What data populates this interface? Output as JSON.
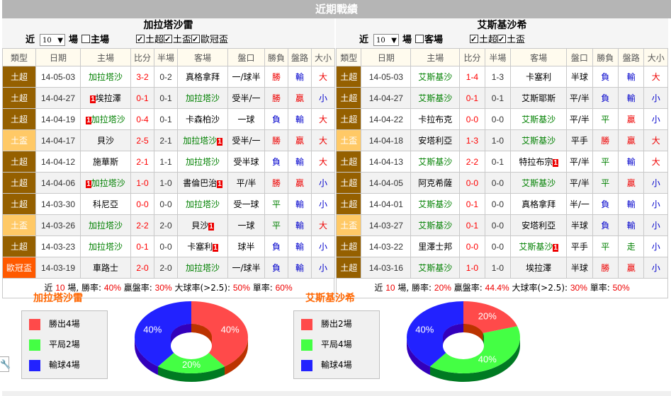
{
  "header": {
    "title": "近期戰績"
  },
  "left": {
    "team": "加拉塔沙雷",
    "controls": {
      "recent_label": "近",
      "count": "10",
      "unit_label": "場",
      "venue_label": "主場",
      "venue_checked": false,
      "filters": [
        {
          "label": "土超",
          "checked": true
        },
        {
          "label": "土盃",
          "checked": true
        },
        {
          "label": "歐冠盃",
          "checked": true
        }
      ]
    },
    "columns": [
      "類型",
      "日期",
      "主場",
      "比分",
      "半場",
      "客場",
      "盤口",
      "勝負",
      "盤路",
      "大小"
    ],
    "rows": [
      {
        "type": "土超",
        "type_kind": "super",
        "date": "14-05-03",
        "home": "加拉塔沙",
        "home_team": true,
        "home_red": "",
        "score": "3-2",
        "half": "0-2",
        "away": "真格拿拜",
        "away_team": false,
        "away_red": "",
        "handicap": "一/球半",
        "result": "勝",
        "hc_result": "輸",
        "ou": "大"
      },
      {
        "type": "土超",
        "type_kind": "super",
        "date": "14-04-27",
        "home": "埃拉澤",
        "home_team": false,
        "home_red": "1",
        "score": "0-1",
        "half": "0-1",
        "away": "加拉塔沙",
        "away_team": true,
        "away_red": "",
        "handicap": "受半/一",
        "result": "勝",
        "hc_result": "贏",
        "ou": "小"
      },
      {
        "type": "土超",
        "type_kind": "super",
        "date": "14-04-19",
        "home": "加拉塔沙",
        "home_team": true,
        "home_red": "1",
        "score": "0-4",
        "half": "0-1",
        "away": "卡森柏沙",
        "away_team": false,
        "away_red": "",
        "handicap": "一球",
        "result": "負",
        "hc_result": "輸",
        "ou": "大"
      },
      {
        "type": "土盃",
        "type_kind": "cup",
        "date": "14-04-17",
        "home": "貝沙",
        "home_team": false,
        "home_red": "",
        "score": "2-5",
        "half": "2-1",
        "away": "加拉塔沙",
        "away_team": true,
        "away_red": "1",
        "handicap": "受半/一",
        "result": "勝",
        "hc_result": "贏",
        "ou": "大"
      },
      {
        "type": "土超",
        "type_kind": "super",
        "date": "14-04-12",
        "home": "施華斯",
        "home_team": false,
        "home_red": "",
        "score": "2-1",
        "half": "1-1",
        "away": "加拉塔沙",
        "away_team": true,
        "away_red": "",
        "handicap": "受半球",
        "result": "負",
        "hc_result": "輸",
        "ou": "大"
      },
      {
        "type": "土超",
        "type_kind": "super",
        "date": "14-04-06",
        "home": "加拉塔沙",
        "home_team": true,
        "home_red": "1",
        "score": "1-0",
        "half": "1-0",
        "away": "書倫巴治",
        "away_team": false,
        "away_red": "1",
        "handicap": "平/半",
        "result": "勝",
        "hc_result": "贏",
        "ou": "小"
      },
      {
        "type": "土超",
        "type_kind": "super",
        "date": "14-03-30",
        "home": "科尼亞",
        "home_team": false,
        "home_red": "",
        "score": "0-0",
        "half": "0-0",
        "away": "加拉塔沙",
        "away_team": true,
        "away_red": "",
        "handicap": "受一球",
        "result": "平",
        "hc_result": "輸",
        "ou": "小"
      },
      {
        "type": "土盃",
        "type_kind": "cup",
        "date": "14-03-26",
        "home": "加拉塔沙",
        "home_team": true,
        "home_red": "",
        "score": "2-2",
        "half": "2-0",
        "away": "貝沙",
        "away_team": false,
        "away_red": "1",
        "handicap": "一球",
        "result": "平",
        "hc_result": "輸",
        "ou": "大"
      },
      {
        "type": "土超",
        "type_kind": "super",
        "date": "14-03-23",
        "home": "加拉塔沙",
        "home_team": true,
        "home_red": "",
        "score": "0-1",
        "half": "0-0",
        "away": "卡塞利",
        "away_team": false,
        "away_red": "1",
        "handicap": "球半",
        "result": "負",
        "hc_result": "輸",
        "ou": "小"
      },
      {
        "type": "歐冠盃",
        "type_kind": "ucl",
        "date": "14-03-19",
        "home": "車路士",
        "home_team": false,
        "home_red": "",
        "score": "2-0",
        "half": "2-0",
        "away": "加拉塔沙",
        "away_team": true,
        "away_red": "",
        "handicap": "一/球半",
        "result": "負",
        "hc_result": "輸",
        "ou": "小"
      }
    ],
    "summary": {
      "prefix": "近",
      "count": "10",
      "suffix": "場,",
      "win_label": "勝率:",
      "win": "40%",
      "hc_label": "贏盤率:",
      "hc": "30%",
      "over_label": "大球率(>2.5):",
      "over": "50%",
      "odd_label": "單率:",
      "odd": "60%"
    }
  },
  "right": {
    "team": "艾斯基沙希",
    "controls": {
      "recent_label": "近",
      "count": "10",
      "unit_label": "場",
      "venue_label": "客場",
      "venue_checked": false,
      "filters": [
        {
          "label": "土超",
          "checked": true
        },
        {
          "label": "土盃",
          "checked": true
        }
      ]
    },
    "columns": [
      "類型",
      "日期",
      "主場",
      "比分",
      "半場",
      "客場",
      "盤口",
      "勝負",
      "盤路",
      "大小"
    ],
    "rows": [
      {
        "type": "土超",
        "type_kind": "super",
        "date": "14-05-03",
        "home": "艾斯基沙",
        "home_team": true,
        "home_red": "",
        "score": "1-4",
        "half": "1-3",
        "away": "卡塞利",
        "away_team": false,
        "away_red": "",
        "handicap": "半球",
        "result": "負",
        "hc_result": "輸",
        "ou": "大"
      },
      {
        "type": "土超",
        "type_kind": "super",
        "date": "14-04-27",
        "home": "艾斯基沙",
        "home_team": true,
        "home_red": "",
        "score": "0-1",
        "half": "0-1",
        "away": "艾斯耶斯",
        "away_team": false,
        "away_red": "",
        "handicap": "平/半",
        "result": "負",
        "hc_result": "輸",
        "ou": "小"
      },
      {
        "type": "土超",
        "type_kind": "super",
        "date": "14-04-22",
        "home": "卡拉布克",
        "home_team": false,
        "home_red": "",
        "score": "0-0",
        "half": "0-0",
        "away": "艾斯基沙",
        "away_team": true,
        "away_red": "",
        "handicap": "平/半",
        "result": "平",
        "hc_result": "贏",
        "ou": "小"
      },
      {
        "type": "土盃",
        "type_kind": "cup",
        "date": "14-04-18",
        "home": "安塔利亞",
        "home_team": false,
        "home_red": "",
        "score": "1-3",
        "half": "1-0",
        "away": "艾斯基沙",
        "away_team": true,
        "away_red": "",
        "handicap": "平手",
        "result": "勝",
        "hc_result": "贏",
        "ou": "大"
      },
      {
        "type": "土超",
        "type_kind": "super",
        "date": "14-04-13",
        "home": "艾斯基沙",
        "home_team": true,
        "home_red": "",
        "score": "2-2",
        "half": "0-1",
        "away": "特拉布宗",
        "away_team": false,
        "away_red": "1",
        "handicap": "平/半",
        "result": "平",
        "hc_result": "輸",
        "ou": "大"
      },
      {
        "type": "土超",
        "type_kind": "super",
        "date": "14-04-05",
        "home": "阿克希薩",
        "home_team": false,
        "home_red": "",
        "score": "0-0",
        "half": "0-0",
        "away": "艾斯基沙",
        "away_team": true,
        "away_red": "",
        "handicap": "平/半",
        "result": "平",
        "hc_result": "贏",
        "ou": "小"
      },
      {
        "type": "土超",
        "type_kind": "super",
        "date": "14-04-01",
        "home": "艾斯基沙",
        "home_team": true,
        "home_red": "",
        "score": "0-1",
        "half": "0-0",
        "away": "真格拿拜",
        "away_team": false,
        "away_red": "",
        "handicap": "半/一",
        "result": "負",
        "hc_result": "輸",
        "ou": "小"
      },
      {
        "type": "土盃",
        "type_kind": "cup",
        "date": "14-03-27",
        "home": "艾斯基沙",
        "home_team": true,
        "home_red": "",
        "score": "0-1",
        "half": "0-0",
        "away": "安塔利亞",
        "away_team": false,
        "away_red": "",
        "handicap": "半球",
        "result": "負",
        "hc_result": "輸",
        "ou": "小"
      },
      {
        "type": "土超",
        "type_kind": "super",
        "date": "14-03-22",
        "home": "里澤士邦",
        "home_team": false,
        "home_red": "",
        "score": "0-0",
        "half": "0-0",
        "away": "艾斯基沙",
        "away_team": true,
        "away_red": "1",
        "handicap": "平手",
        "result": "平",
        "hc_result": "走",
        "ou": "小"
      },
      {
        "type": "土超",
        "type_kind": "super",
        "date": "14-03-16",
        "home": "艾斯基沙",
        "home_team": true,
        "home_red": "",
        "score": "1-0",
        "half": "1-0",
        "away": "埃拉澤",
        "away_team": false,
        "away_red": "",
        "handicap": "半球",
        "result": "勝",
        "hc_result": "贏",
        "ou": "小"
      }
    ],
    "summary": {
      "prefix": "近",
      "count": "10",
      "suffix": "場,",
      "win_label": "勝率:",
      "win": "20%",
      "hc_label": "贏盤率:",
      "hc": "44.4%",
      "over_label": "大球率(>2.5):",
      "over": "30%",
      "odd_label": "單率:",
      "odd": "50%"
    }
  },
  "colors": {
    "win": "#ff4a4a",
    "draw": "#44ff44",
    "loss": "#2222ff",
    "type_super": "#956000",
    "type_cup": "#ffc966",
    "type_ucl": "#ff5a00",
    "team_highlight": "#008000",
    "title_orange": "#ff6600"
  },
  "chart_data": [
    {
      "type": "pie",
      "title": "加拉塔沙雷",
      "legend": [
        "勝出4場",
        "平局2場",
        "輸球4場"
      ],
      "categories": [
        "勝出",
        "平局",
        "輸球"
      ],
      "values": [
        4,
        2,
        4
      ],
      "labels": [
        "40%",
        "20%",
        "40%"
      ],
      "colors": [
        "#ff4a4a",
        "#44ff44",
        "#2222ff"
      ],
      "legend_position": "left"
    },
    {
      "type": "pie",
      "title": "艾斯基沙希",
      "legend": [
        "勝出2場",
        "平局4場",
        "輸球4場"
      ],
      "categories": [
        "勝出",
        "平局",
        "輸球"
      ],
      "values": [
        2,
        4,
        4
      ],
      "labels": [
        "20%",
        "40%",
        "40%"
      ],
      "colors": [
        "#ff4a4a",
        "#44ff44",
        "#2222ff"
      ],
      "legend_position": "left"
    }
  ]
}
